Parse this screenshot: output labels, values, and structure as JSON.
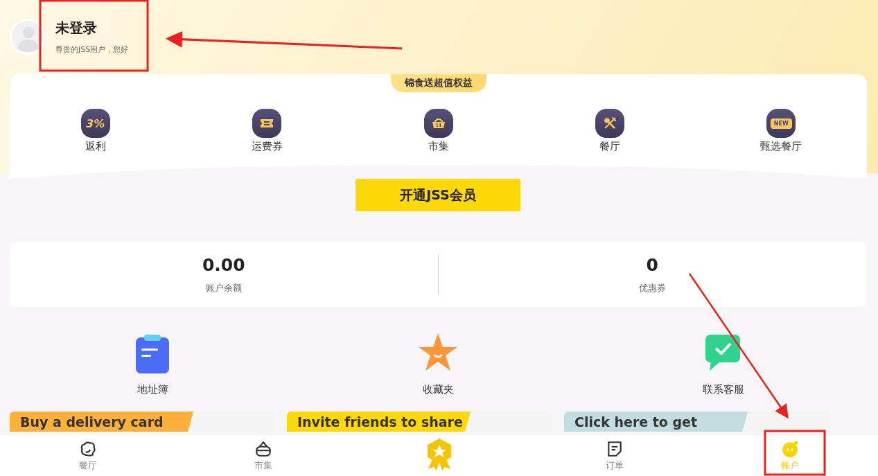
{
  "profile": {
    "name": "未登录",
    "greeting": "尊贵的JSS用户，您好"
  },
  "benefits": {
    "title": "锦食送超值权益",
    "items": [
      {
        "kind": "rebate",
        "label": "返利",
        "badge": "3%"
      },
      {
        "kind": "ticket",
        "label": "运费券"
      },
      {
        "kind": "basket",
        "label": "市集"
      },
      {
        "kind": "dining",
        "label": "餐厅"
      },
      {
        "kind": "new",
        "label": "甄选餐厅",
        "badge": "NEW"
      }
    ]
  },
  "member_button": "开通JSS会员",
  "stats": [
    {
      "value": "0.00",
      "label": "账户余额"
    },
    {
      "value": "0",
      "label": "优惠券"
    }
  ],
  "shortcuts": [
    {
      "kind": "address",
      "label": "地址簿"
    },
    {
      "kind": "favorite",
      "label": "收藏夹"
    },
    {
      "kind": "service",
      "label": "联系客服"
    }
  ],
  "banners": [
    {
      "kind": "delivery",
      "text": "Buy a delivery card"
    },
    {
      "kind": "invite",
      "text": "Invite friends to share"
    },
    {
      "kind": "coupon",
      "text": "Click here to get"
    }
  ],
  "tabs": [
    {
      "kind": "restaurant",
      "label": "餐厅",
      "selected": false
    },
    {
      "kind": "market",
      "label": "市集",
      "selected": false
    },
    {
      "kind": "member",
      "selected": false
    },
    {
      "kind": "orders",
      "label": "订单",
      "selected": false
    },
    {
      "kind": "account",
      "label": "账户",
      "selected": true
    }
  ]
}
